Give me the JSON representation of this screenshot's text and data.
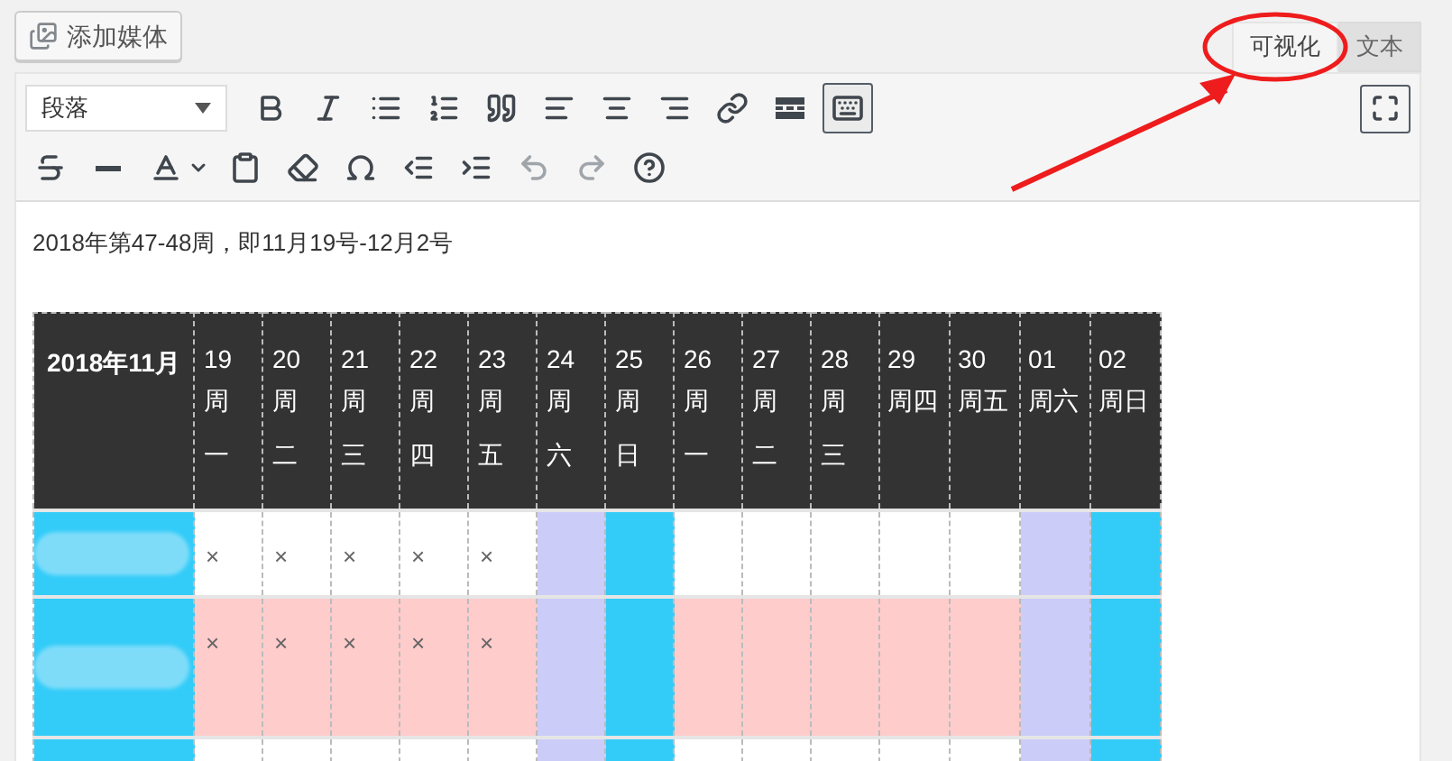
{
  "add_media_button": {
    "label": "添加媒体"
  },
  "tabs": [
    {
      "label": "可视化",
      "selected": true
    },
    {
      "label": "文本",
      "selected": false
    }
  ],
  "toolbar": {
    "format_select": {
      "value": "段落"
    },
    "row_1": [
      {
        "kind": "bold",
        "pressed": false
      },
      {
        "kind": "italic",
        "pressed": false
      },
      {
        "kind": "bullets",
        "pressed": false
      },
      {
        "kind": "numbers",
        "pressed": false
      },
      {
        "kind": "quote",
        "pressed": false
      },
      {
        "kind": "align-left",
        "pressed": false
      },
      {
        "kind": "align-center",
        "pressed": false
      },
      {
        "kind": "align-right",
        "pressed": false
      },
      {
        "kind": "link",
        "pressed": false
      },
      {
        "kind": "more",
        "pressed": false
      },
      {
        "kind": "keyboard",
        "pressed": true
      }
    ],
    "row_2": [
      {
        "kind": "strike",
        "disabled": false
      },
      {
        "kind": "hr",
        "disabled": false
      },
      {
        "kind": "text-color",
        "disabled": false
      },
      {
        "kind": "paste",
        "disabled": false
      },
      {
        "kind": "eraser",
        "disabled": false
      },
      {
        "kind": "omega",
        "disabled": false
      },
      {
        "kind": "outdent",
        "disabled": false
      },
      {
        "kind": "indent",
        "disabled": false
      },
      {
        "kind": "undo",
        "disabled": true
      },
      {
        "kind": "redo",
        "disabled": true
      },
      {
        "kind": "help",
        "disabled": false
      }
    ]
  },
  "content": {
    "paragraph": "2018年第47-48周，即11月19号-12月2号",
    "table": {
      "corner": "2018年11月",
      "columns": [
        {
          "day": "19",
          "weekday": "周一"
        },
        {
          "day": "20",
          "weekday": "周二"
        },
        {
          "day": "21",
          "weekday": "周三"
        },
        {
          "day": "22",
          "weekday": "周四"
        },
        {
          "day": "23",
          "weekday": "周五"
        },
        {
          "day": "24",
          "weekday": "周六",
          "color": "#ccccf9"
        },
        {
          "day": "25",
          "weekday": "周日",
          "color": "#33ccf9"
        },
        {
          "day": "26",
          "weekday": "周一"
        },
        {
          "day": "27",
          "weekday": "周二"
        },
        {
          "day": "28",
          "weekday": "周三"
        },
        {
          "day": "29",
          "weekday": "周四"
        },
        {
          "day": "30",
          "weekday": "周五"
        },
        {
          "day": "01",
          "weekday": "周六",
          "color": "#ccccf9"
        },
        {
          "day": "02",
          "weekday": "周日",
          "color": "#33ccf9"
        }
      ],
      "rows": [
        {
          "color": "#ffffff",
          "marks": [
            "×",
            "×",
            "×",
            "×",
            "×"
          ]
        },
        {
          "color": "#ffcccc",
          "marks": [
            "×",
            "×",
            "×",
            "×",
            "×"
          ]
        },
        {
          "color": "#ffffff"
        }
      ]
    }
  }
}
